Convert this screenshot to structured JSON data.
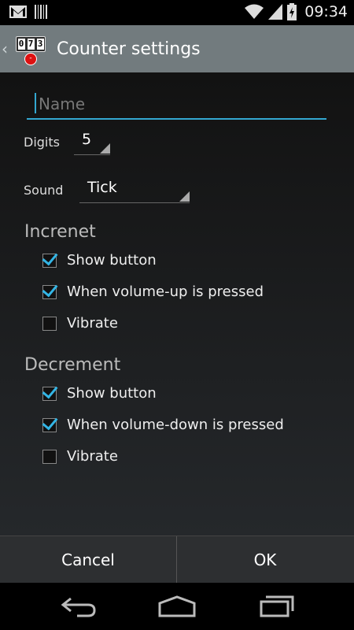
{
  "status_bar": {
    "time": "09:34",
    "icons": [
      "gmail-icon",
      "barcode-icon",
      "wifi-icon",
      "signal-icon",
      "battery-icon"
    ]
  },
  "action_bar": {
    "title": "Counter settings",
    "app_icon_digits": [
      "0",
      "7",
      "3"
    ],
    "app_icon_button": "-"
  },
  "form": {
    "name_placeholder": "Name",
    "name_value": "",
    "digits_label": "Digits",
    "digits_value": "5",
    "sound_label": "Sound",
    "sound_value": "Tick"
  },
  "increment": {
    "title": "Increnet",
    "options": [
      {
        "label": "Show button",
        "checked": true
      },
      {
        "label": "When volume-up is pressed",
        "checked": true
      },
      {
        "label": "Vibrate",
        "checked": false
      }
    ]
  },
  "decrement": {
    "title": "Decrement",
    "options": [
      {
        "label": "Show button",
        "checked": true
      },
      {
        "label": "When volume-down is pressed",
        "checked": true
      },
      {
        "label": "Vibrate",
        "checked": false
      }
    ]
  },
  "buttons": {
    "cancel": "Cancel",
    "ok": "OK"
  },
  "colors": {
    "accent": "#33b5e5",
    "action_bar": "#727b7e"
  }
}
